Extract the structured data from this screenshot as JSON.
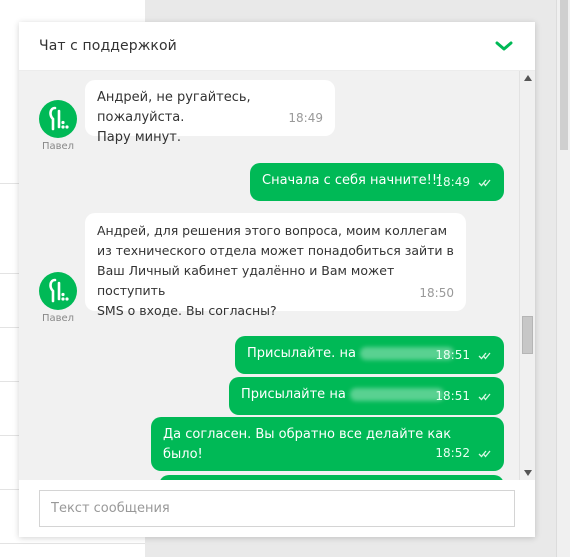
{
  "colors": {
    "brand_green": "#00b956",
    "bubble_in": "#ffffff",
    "chat_bg": "#f1f1f1"
  },
  "header": {
    "title": "Чат с поддержкой",
    "collapse_icon": "chevron-down-icon"
  },
  "messages": [
    {
      "from": "agent",
      "sender": "Павел",
      "text": "Андрей, не ругайтесь, пожалуйста.\nПару минут.",
      "time": "18:49"
    },
    {
      "from": "user",
      "text": "Сначала с себя начните!!!",
      "time": "18:49"
    },
    {
      "from": "agent",
      "sender": "Павел",
      "text": "Андрей, для решения этого вопроса, моим коллегам\nиз технического отдела может понадобиться зайти в\nВаш Личный кабинет удалённо и Вам может поступить\nSMS о входе. Вы согласны?",
      "time": "18:50"
    },
    {
      "from": "user",
      "text": "Присылайте. на",
      "time": "18:51"
    },
    {
      "from": "user",
      "text": "Присылайте на",
      "time": "18:51"
    },
    {
      "from": "user",
      "text": "Да согласен. Вы обратно все делайте как было!",
      "time": "18:52"
    }
  ],
  "input": {
    "placeholder": "Текст сообщения",
    "value": ""
  }
}
